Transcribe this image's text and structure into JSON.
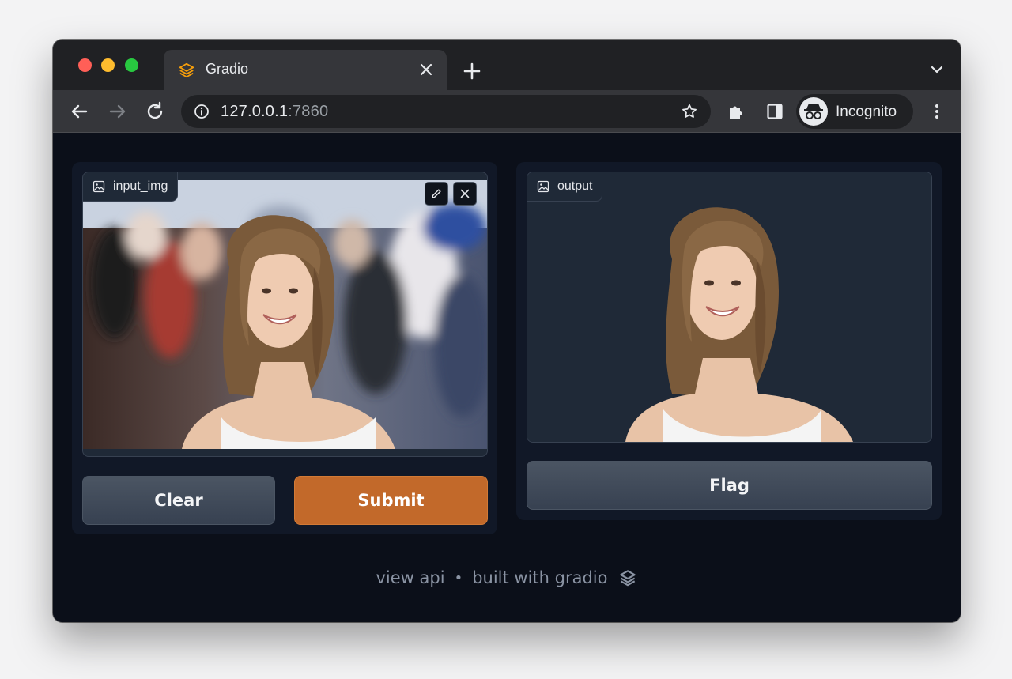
{
  "browser": {
    "tab_title": "Gradio",
    "url_host": "127.0.0.1",
    "url_port": ":7860",
    "profile_label": "Incognito"
  },
  "input_panel": {
    "label": "input_img",
    "clear_label": "Clear",
    "submit_label": "Submit"
  },
  "output_panel": {
    "label": "output",
    "flag_label": "Flag"
  },
  "footer": {
    "view_api": "view api",
    "separator": "•",
    "built_with": "built with gradio"
  },
  "colors": {
    "accent_submit": "#c2692a",
    "page_bg": "#0b0f19",
    "panel_bg": "#111827",
    "block_bg": "#1f2937"
  }
}
